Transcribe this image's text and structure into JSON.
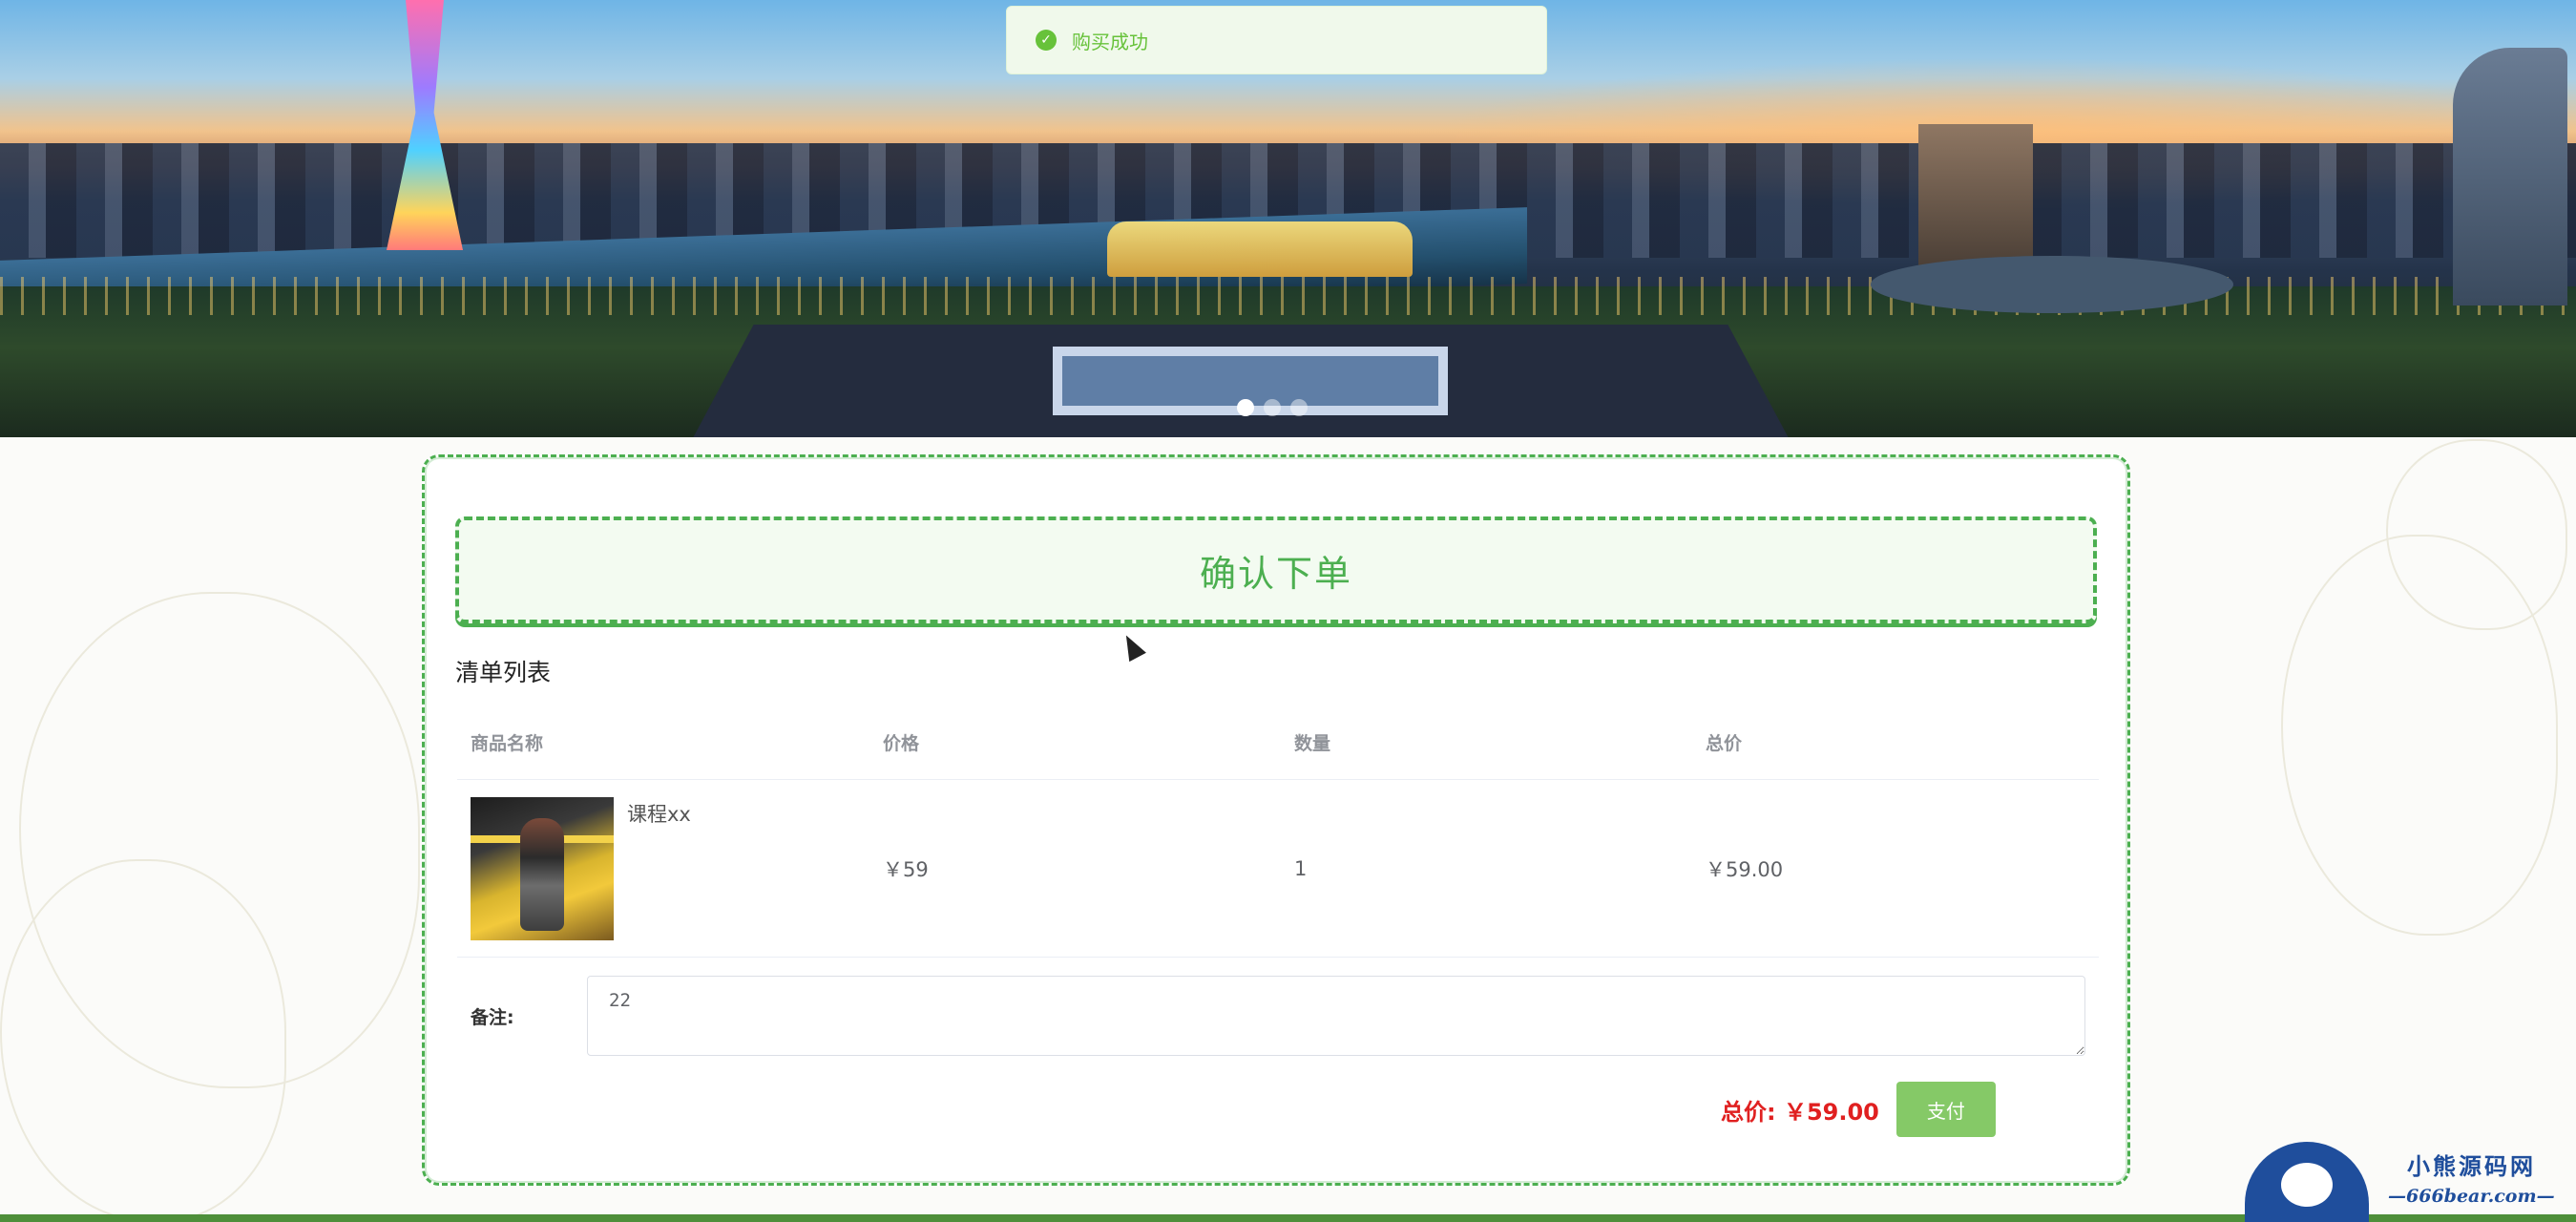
{
  "toast": {
    "message": "购买成功",
    "icon": "check-circle-icon",
    "color": "#67c23a"
  },
  "banner": {
    "slides_count": 3,
    "active_slide": 1
  },
  "order": {
    "header_title": "确认下单",
    "list_title": "清单列表",
    "columns": [
      "商品名称",
      "价格",
      "数量",
      "总价"
    ],
    "items": [
      {
        "name": "课程xx",
        "price": "￥59",
        "quantity": "1",
        "subtotal": "￥59.00"
      }
    ],
    "remark_label": "备注:",
    "remark_value": "22",
    "total_label": "总价: ￥59.00",
    "pay_label": "支付"
  },
  "watermark": {
    "title": "小熊源码网",
    "url": "—666bear.com—"
  },
  "colors": {
    "accent": "#4caf50",
    "pay_button": "#85c967",
    "total": "#e02020"
  }
}
